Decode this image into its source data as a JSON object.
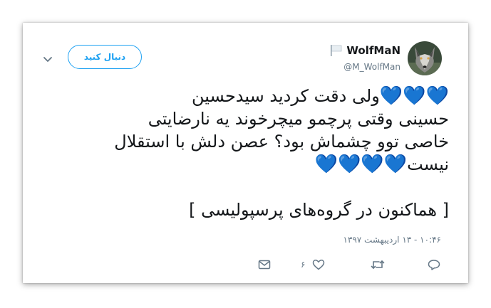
{
  "tweet": {
    "display_name": "WolfMaN",
    "handle": "@M_WolfMan",
    "follow_label": "دنبال کنید",
    "text_lines": [
      "💙💙💙ولی دقت کردید سیدحسین",
      "حسینی وقتی پرچمو میچرخوند یه نارضایتی",
      "خاصی توو چشماش بود؟ عصن دلش با استقلال",
      "نیست💙💙💙💙"
    ],
    "footer_line": "[ هماکنون در گروه‌های پرسپولیسی ]",
    "timestamp": "۱۰:۴۶ - ۱۳ اردیبهشت ۱۳۹۷",
    "like_count": "۶"
  },
  "icons": {
    "flag": "flag-icon",
    "chevron": "chevron-down-icon",
    "reply": "reply-icon",
    "retweet": "retweet-icon",
    "like": "heart-icon",
    "dm": "envelope-icon"
  },
  "colors": {
    "accent": "#1da1f2",
    "text": "#14171a",
    "muted": "#657786",
    "heart_emoji": "#5dadec"
  }
}
